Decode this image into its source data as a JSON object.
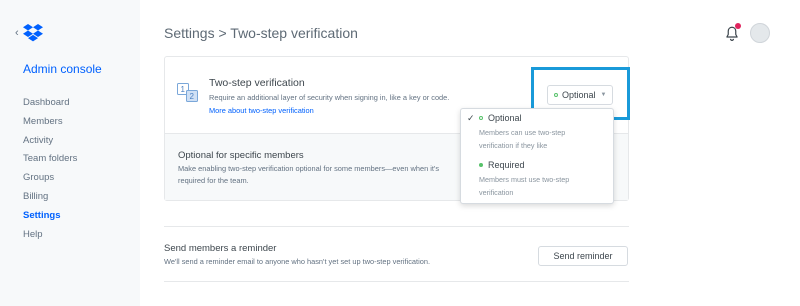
{
  "sidebar": {
    "admin_console": "Admin console",
    "items": [
      {
        "label": "Dashboard"
      },
      {
        "label": "Members"
      },
      {
        "label": "Activity"
      },
      {
        "label": "Team folders"
      },
      {
        "label": "Groups"
      },
      {
        "label": "Billing"
      },
      {
        "label": "Settings",
        "active": true
      },
      {
        "label": "Help"
      }
    ]
  },
  "header": {
    "title": "Settings > Two-step verification",
    "has_notification": true
  },
  "two_step": {
    "title": "Two-step verification",
    "description": "Require an additional layer of security when signing in, like a key or code.",
    "link": "More about two-step verification",
    "selected_value": "Optional"
  },
  "specific": {
    "title": "Optional for specific members",
    "description": "Make enabling two-step verification optional for some members—even when it's required for the team."
  },
  "dropdown": {
    "options": [
      {
        "label": "Optional",
        "description": "Members can use two-step verification if they like",
        "checked": true
      },
      {
        "label": "Required",
        "description": "Members must use two-step verification",
        "checked": false
      }
    ]
  },
  "reminder": {
    "title": "Send members a reminder",
    "description": "We'll send a reminder email to anyone who hasn't yet set up two-step verification.",
    "button": "Send reminder"
  },
  "colors": {
    "accent": "#0061fe",
    "highlight": "#199ad9",
    "status_green": "#57c26a",
    "notification": "#e0245e"
  },
  "icons": [
    "back-chevron-icon",
    "dropbox-logo-icon",
    "two-step-icon",
    "bell-icon",
    "chevron-down-icon",
    "check-icon"
  ]
}
